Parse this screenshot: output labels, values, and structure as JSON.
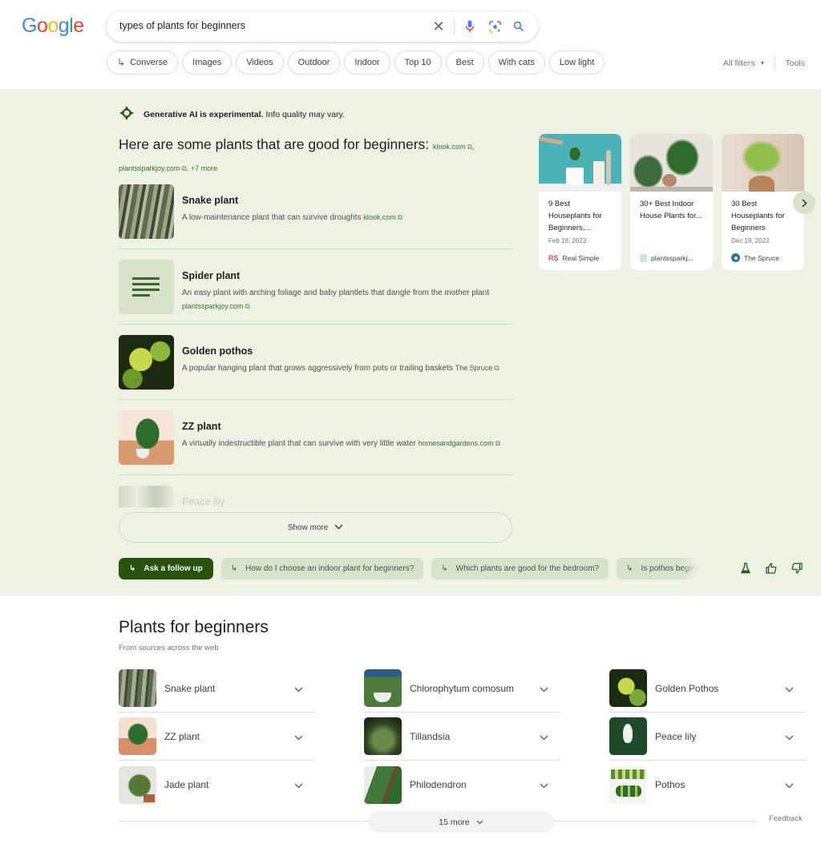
{
  "header": {
    "logo": [
      "G",
      "o",
      "o",
      "g",
      "l",
      "e"
    ],
    "search": {
      "query": "types of plants for beginners"
    },
    "chips": [
      {
        "label": "Converse",
        "icon": "arrow-subdirectory-icon"
      },
      {
        "label": "Images"
      },
      {
        "label": "Videos"
      },
      {
        "label": "Outdoor"
      },
      {
        "label": "Indoor"
      },
      {
        "label": "Top 10"
      },
      {
        "label": "Best"
      },
      {
        "label": "With cats"
      },
      {
        "label": "Low light"
      }
    ],
    "all_filters": "All filters",
    "tools": "Tools"
  },
  "ai_overview": {
    "notice_bold": "Generative AI is experimental.",
    "notice_rest": " Info quality may vary.",
    "heading": "Here are some plants that are good for beginners:",
    "heading_sources": [
      "klook.com",
      "plantssparkjoy.com"
    ],
    "more_sources": "+7 more",
    "plants": [
      {
        "name": "Snake plant",
        "desc": "A low-maintenance plant that can survive droughts",
        "source": "klook.com"
      },
      {
        "name": "Spider plant",
        "desc": "An easy plant with arching foliage and baby plantlets that dangle from the mother plant",
        "source": "plantssparkjoy.com"
      },
      {
        "name": "Golden pothos",
        "desc": "A popular hanging plant that grows aggressively from pots or trailing baskets",
        "source": "The Spruce"
      },
      {
        "name": "ZZ plant",
        "desc": "A virtually indestructible plant that can survive with very little water",
        "source": "homesandgardens.com"
      },
      {
        "name": "Peace lily",
        "desc": "",
        "source": ""
      }
    ],
    "show_more": "Show more",
    "ask_follow_up": "Ask a follow up",
    "suggestions": [
      "How do I choose an indoor plant for beginners?",
      "Which plants are good for the bedroom?",
      "Is pothos beginner friendly?"
    ],
    "cards": [
      {
        "title": "9 Best Houseplants for Beginners,...",
        "date": "Feb 18, 2023",
        "source": "Real Simple",
        "source_badge": "RS"
      },
      {
        "title": "30+ Best Indoor House Plants for...",
        "date": "",
        "source": "plantssparkj...",
        "source_badge": ""
      },
      {
        "title": "30 Best Houseplants for Beginners",
        "date": "Dec 19, 2022",
        "source": "The Spruce",
        "source_badge": ""
      }
    ]
  },
  "plants_for_beginners": {
    "title": "Plants for beginners",
    "subtitle": "From sources across the web",
    "columns": [
      [
        "Snake plant",
        "ZZ plant",
        "Jade plant"
      ],
      [
        "Chlorophytum comosum",
        "Tillandsia",
        "Philodendron"
      ],
      [
        "Golden Pothos",
        "Peace lily",
        "Pothos"
      ]
    ],
    "more_label": "15 more",
    "feedback": "Feedback"
  },
  "colors": {
    "ai_background": "#edf2e2",
    "ai_accent": "#29520f",
    "chip_suggestion": "#d7e3c9",
    "link_green": "#3c6d2c"
  }
}
